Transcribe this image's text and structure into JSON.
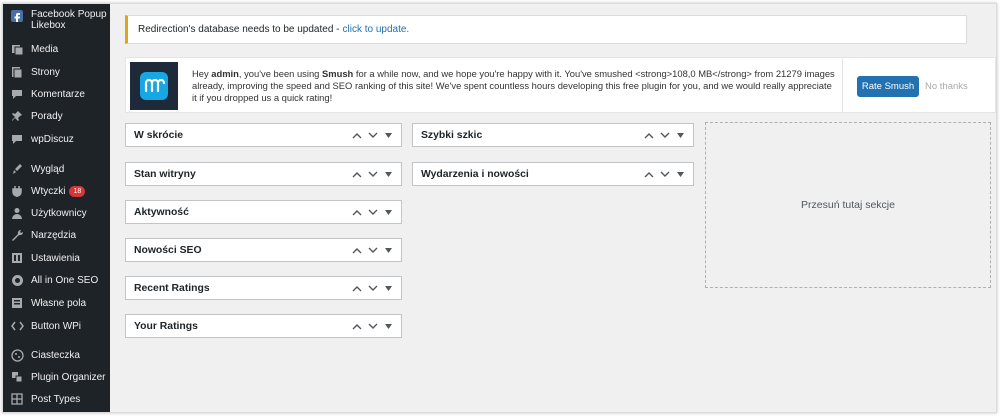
{
  "sidebar": {
    "items": [
      {
        "label": "Facebook Popup Likebox",
        "icon": "fb-popup-icon"
      },
      {
        "label": "Media",
        "icon": "media-icon"
      },
      {
        "label": "Strony",
        "icon": "pages-icon"
      },
      {
        "label": "Komentarze",
        "icon": "comments-icon"
      },
      {
        "label": "Porady",
        "icon": "pin-icon"
      },
      {
        "label": "wpDiscuz",
        "icon": "discuz-icon"
      },
      {
        "label": "Wygląd",
        "icon": "appearance-icon"
      },
      {
        "label": "Wtyczki",
        "icon": "plugins-icon",
        "badge": "18"
      },
      {
        "label": "Użytkownicy",
        "icon": "users-icon"
      },
      {
        "label": "Narzędzia",
        "icon": "tools-icon"
      },
      {
        "label": "Ustawienia",
        "icon": "settings-icon"
      },
      {
        "label": "All in One SEO",
        "icon": "aioseo-icon"
      },
      {
        "label": "Własne pola",
        "icon": "custom-fields-icon"
      },
      {
        "label": "Button WPi",
        "icon": "button-wpi-icon"
      },
      {
        "label": "Ciasteczka",
        "icon": "cookie-icon"
      },
      {
        "label": "Plugin Organizer",
        "icon": "plugin-organizer-icon"
      },
      {
        "label": "Post Types",
        "icon": "post-types-icon"
      }
    ]
  },
  "notice": {
    "text": "Redirection's database needs to be updated -",
    "link": "click to update."
  },
  "smush": {
    "hey": "Hey ",
    "user": "admin",
    "mid": ", you've been using ",
    "product": "Smush",
    "rest": " for a while now, and we hope you're happy with it. You've smushed <strong>108,0 MB</strong> from 21279 images already, improving the speed and SEO ranking of this site! We've spent countless hours developing this free plugin for you, and we would really appreciate it if you dropped us a quick rating!",
    "rate_button": "Rate Smush",
    "no_thanks": "No thanks"
  },
  "widgets": {
    "col1": [
      "W skrócie",
      "Stan witryny",
      "Aktywność",
      "Nowości SEO",
      "Recent Ratings",
      "Your Ratings"
    ],
    "col2": [
      "Szybki szkic",
      "Wydarzenia i nowości"
    ]
  },
  "dropzone": {
    "text": "Przesuń tutaj sekcje"
  }
}
